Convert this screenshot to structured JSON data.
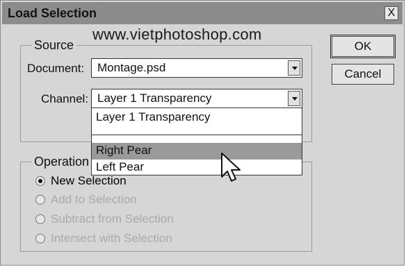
{
  "window": {
    "title": "Load Selection",
    "close_glyph": "X"
  },
  "watermark": "www.vietphotoshop.com",
  "source": {
    "group_label": "Source",
    "document_label": "Document:",
    "document_value": "Montage.psd",
    "channel_label": "Channel:",
    "channel_value": "Layer 1 Transparency",
    "channel_options": [
      {
        "label": "Layer 1 Transparency",
        "highlighted": false
      },
      {
        "label": "",
        "highlighted": false
      },
      {
        "label": "Right Pear",
        "highlighted": true
      },
      {
        "label": "Left Pear",
        "highlighted": false
      }
    ]
  },
  "buttons": {
    "ok": "OK",
    "cancel": "Cancel"
  },
  "operation": {
    "group_label": "Operation",
    "options": [
      {
        "label": "New Selection",
        "selected": true,
        "enabled": true
      },
      {
        "label": "Add to Selection",
        "selected": false,
        "enabled": false
      },
      {
        "label": "Subtract from Selection",
        "selected": false,
        "enabled": false
      },
      {
        "label": "Intersect with Selection",
        "selected": false,
        "enabled": false
      }
    ]
  },
  "colors": {
    "dialog_bg": "#d6d6d6",
    "titlebar": "#8c8c8c",
    "highlight": "#9a9a9a",
    "disabled_text": "#a9a9a9"
  },
  "icons": {
    "cursor": "arrow-pointer-icon",
    "close": "close-icon",
    "dropdown": "chevron-down-icon"
  }
}
